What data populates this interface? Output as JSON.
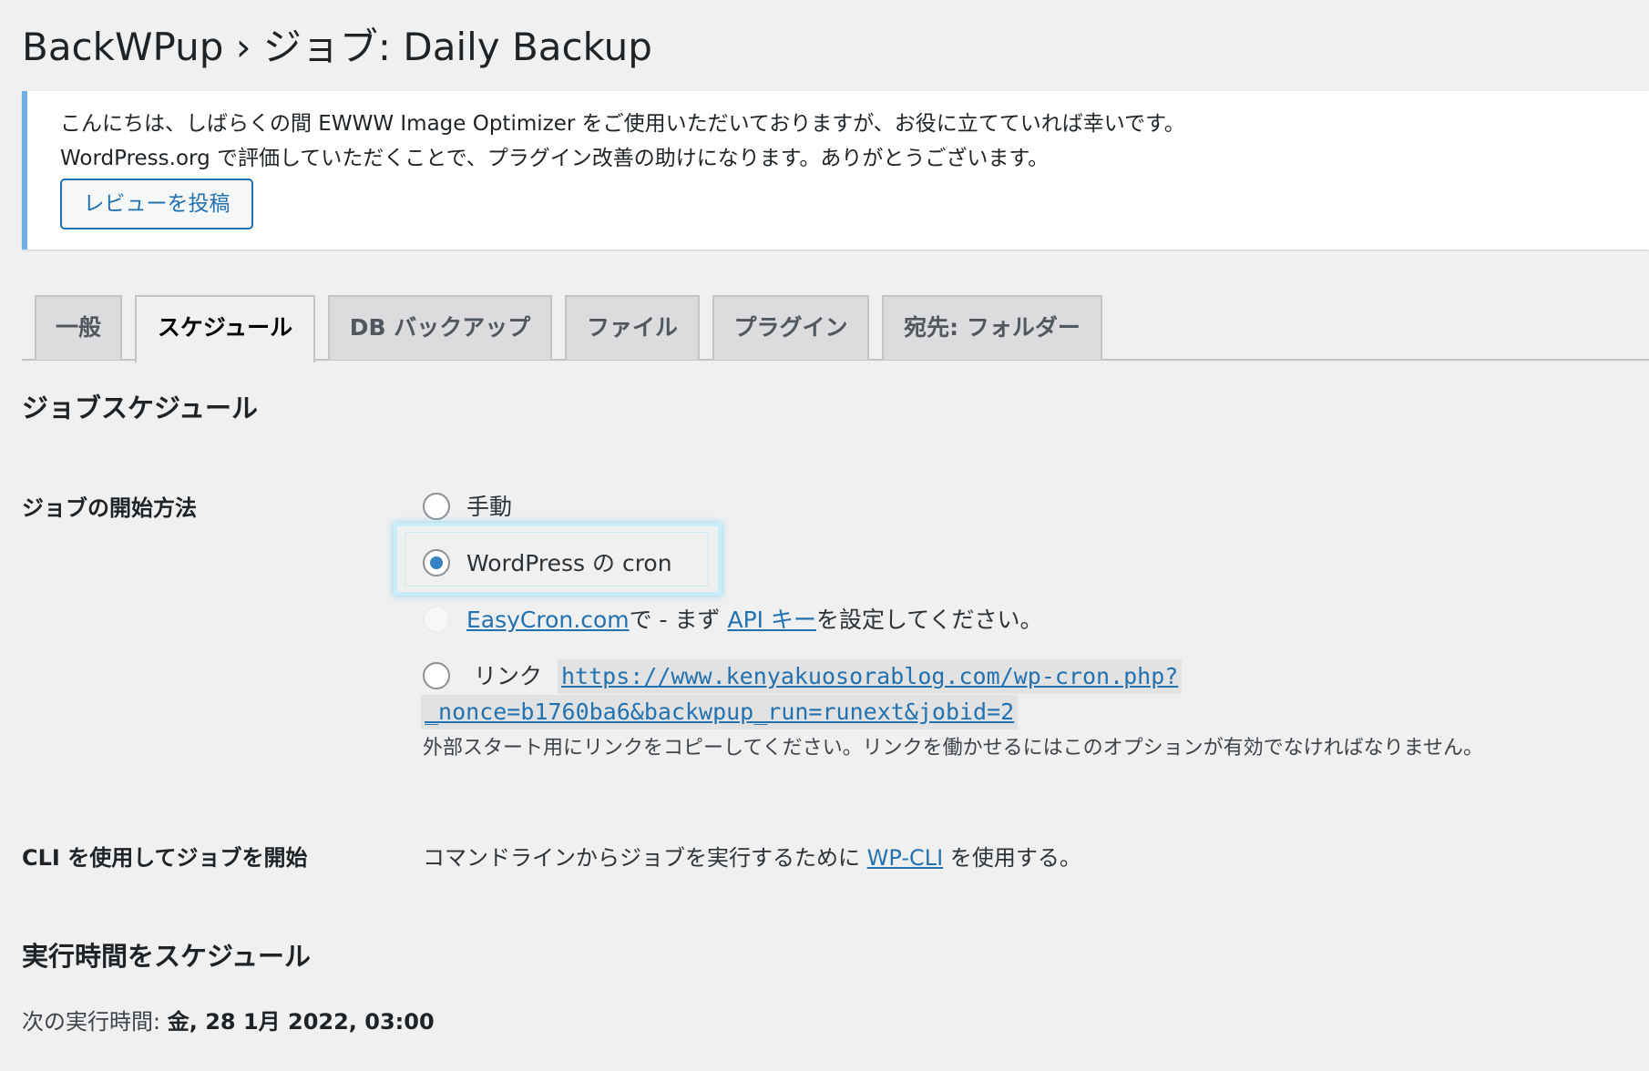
{
  "page": {
    "title": "BackWPup › ジョブ: Daily Backup"
  },
  "notice": {
    "line1": "こんにちは、しばらくの間 EWWW Image Optimizer をご使用いただいておりますが、お役に立てていれば幸いです。",
    "line2": "WordPress.org で評価していただくことで、プラグイン改善の助けになります。ありがとうございます。",
    "review_button": "レビューを投稿"
  },
  "tabs": [
    {
      "label": "一般",
      "active": false
    },
    {
      "label": "スケジュール",
      "active": true
    },
    {
      "label": "DB バックアップ",
      "active": false
    },
    {
      "label": "ファイル",
      "active": false
    },
    {
      "label": "プラグイン",
      "active": false
    },
    {
      "label": "宛先: フォルダー",
      "active": false
    }
  ],
  "schedule": {
    "section_title": "ジョブスケジュール",
    "start_method_label": "ジョブの開始方法",
    "options": {
      "manual": "手動",
      "wpcron": "WordPress の cron",
      "easycron_link": "EasyCron.com",
      "easycron_mid": "で - まず",
      "api_key_link": "API キー",
      "easycron_tail": "を設定してください。",
      "link_label": "リンク",
      "link_url_line1": "https://www.kenyakuosorablog.com/wp-cron.php?",
      "link_url_line2": "_nonce=b1760ba6&backwpup_run=runext&jobid=2",
      "link_desc": "外部スタート用にリンクをコピーしてください。リンクを働かせるにはこのオプションが有効でなければなりません。"
    },
    "selected": "wpcron",
    "cli_label": "CLI を使用してジョブを開始",
    "cli_text_pre": "コマンドラインからジョブを実行するために",
    "cli_link": "WP-CLI",
    "cli_text_post": "を使用する。"
  },
  "run_time": {
    "section_title": "実行時間をスケジュール",
    "next_run_label": "次の実行時間:",
    "next_run_value": "金, 28 1月 2022, 03:00"
  },
  "colors": {
    "accent": "#2271b1",
    "notice_border": "#72aee6",
    "radio_checked": "#3582c4",
    "background": "#f0f0f1"
  }
}
